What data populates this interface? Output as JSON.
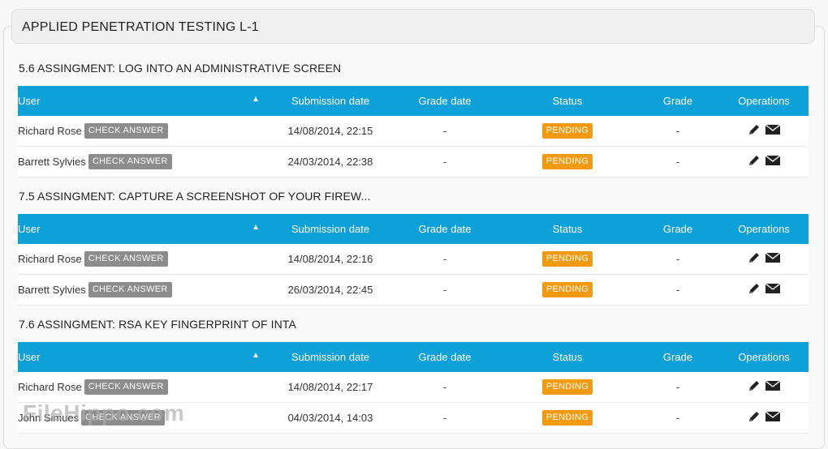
{
  "course": {
    "title": "APPLIED PENETRATION TESTING L-1"
  },
  "columns": {
    "user": "User",
    "submission_date": "Submission date",
    "grade_date": "Grade date",
    "status": "Status",
    "grade": "Grade",
    "operations": "Operations"
  },
  "check_answer_label": "CHECK ANSWER",
  "assignments": [
    {
      "title": "5.6 ASSINGMENT: LOG INTO AN ADMINISTRATIVE SCREEN",
      "rows": [
        {
          "user": "Richard Rose",
          "submission_date": "14/08/2014, 22:15",
          "grade_date": "-",
          "status": "PENDING",
          "grade": "-"
        },
        {
          "user": "Barrett Sylvies",
          "submission_date": "24/03/2014, 22:38",
          "grade_date": "-",
          "status": "PENDING",
          "grade": "-"
        }
      ]
    },
    {
      "title": "7.5 ASSINGMENT: CAPTURE A SCREENSHOT OF YOUR FIREW...",
      "rows": [
        {
          "user": "Richard Rose",
          "submission_date": "14/08/2014, 22:16",
          "grade_date": "-",
          "status": "PENDING",
          "grade": "-"
        },
        {
          "user": "Barrett Sylvies",
          "submission_date": "26/03/2014, 22:45",
          "grade_date": "-",
          "status": "PENDING",
          "grade": "-"
        }
      ]
    },
    {
      "title": "7.6 ASSINGMENT: RSA KEY FINGERPRINT OF INTA",
      "rows": [
        {
          "user": "Richard Rose",
          "submission_date": "14/08/2014, 22:17",
          "grade_date": "-",
          "status": "PENDING",
          "grade": "-"
        },
        {
          "user": "John Simues",
          "submission_date": "04/03/2014, 14:03",
          "grade_date": "-",
          "status": "PENDING",
          "grade": "-"
        }
      ]
    }
  ],
  "icons": {
    "edit": "pencil-icon",
    "message": "envelope-icon"
  },
  "colors": {
    "header": "#0ea0d8",
    "pending": "#f39a10",
    "check_button": "#8c8c8c"
  },
  "watermark": "FileHippo.com"
}
